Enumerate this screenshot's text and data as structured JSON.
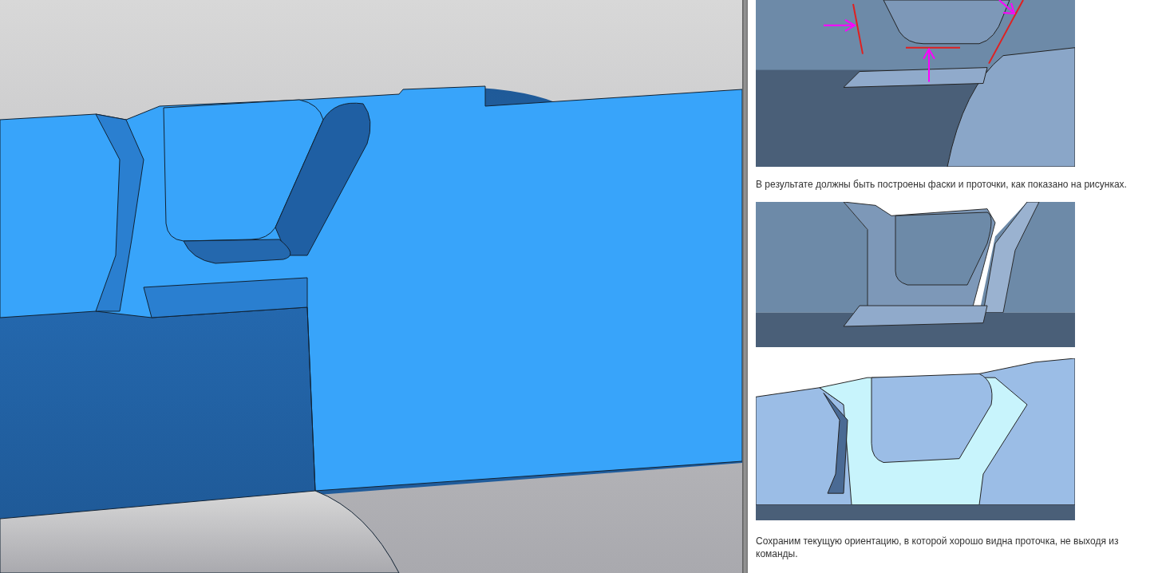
{
  "viewport": {
    "kind": "model"
  },
  "help_panel": {
    "items": [
      {
        "kind": "callout-figure"
      },
      {
        "kind": "text",
        "text": "В результате должны быть построены фаски и проточки, как показано на рисунках."
      },
      {
        "kind": "result-figure"
      },
      {
        "kind": "highlight-figure"
      },
      {
        "kind": "text",
        "text": "Сохраним текущую ориентацию, в которой хорошо видна проточка, не выходя из команды."
      }
    ]
  }
}
